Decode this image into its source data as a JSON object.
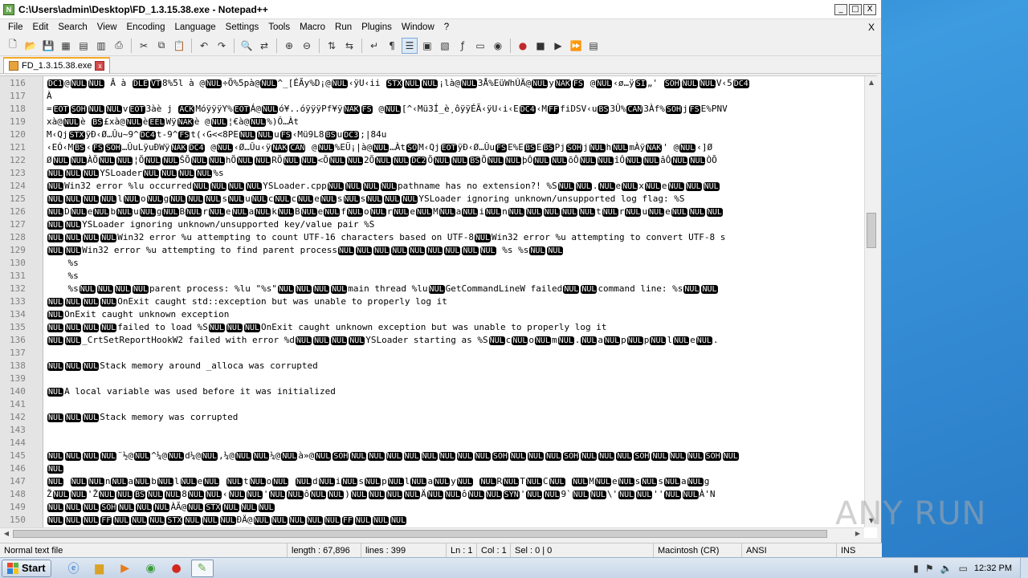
{
  "window": {
    "title": "C:\\Users\\admin\\Desktop\\FD_1.3.15.38.exe - Notepad++",
    "minimize": "_",
    "maximize": "□",
    "close": "X"
  },
  "menu": [
    "File",
    "Edit",
    "Search",
    "View",
    "Encoding",
    "Language",
    "Settings",
    "Tools",
    "Macro",
    "Run",
    "Plugins",
    "Window",
    "?"
  ],
  "menu_close_doc": "X",
  "toolbar_icons": [
    "new-file-icon",
    "open-file-icon",
    "save-icon",
    "save-all-icon",
    "close-icon",
    "close-all-icon",
    "print-icon",
    "cut-icon",
    "copy-icon",
    "paste-icon",
    "undo-icon",
    "redo-icon",
    "find-icon",
    "replace-icon",
    "zoom-in-icon",
    "zoom-out-icon",
    "sync-v-icon",
    "sync-h-icon",
    "word-wrap-icon",
    "all-chars-icon",
    "indent-guide-icon",
    "udl-icon",
    "doc-map-icon",
    "function-list-icon",
    "folder-workspace-icon",
    "monitor-icon",
    "record-icon",
    "stop-icon",
    "play-icon",
    "play-multiple-icon",
    "save-macro-icon"
  ],
  "tab": {
    "label": "FD_1.3.15.38.exe",
    "close": "x"
  },
  "lines": [
    {
      "n": "116",
      "text": "DC1@NULNUL Â à DLEVT8%5l à @NUL÷Ö%5pà@NUL^_[ÉÃy%D¡@NUL‹ÿU‹ii STXNULNUL¡là@NUL3Å%EüWhÚÄ@NULyNAKFS @NUL‹ø…ÿSI„' SOHNULNULV‹5DC4"
    },
    {
      "n": "117",
      "text": "À"
    },
    {
      "n": "118",
      "text": "=EOTSOHNULNULvEOT3àè j ACKMóÿÿÿY%EOTÁ@NULó¥..óÿÿÿPf¥ÿNAKFS @NUL[^‹Mü3Í_è¸ôÿÿÉÃ‹ÿU‹i‹EDC4‹MFFfiDSV‹uBS3Û%CAN3Àf%SOHjFSE%PNV"
    },
    {
      "n": "119",
      "text": "xà@NULè BS£xà@NULèEELWÿNAKè @NUL¦€à@NUL%)Ô…Àt"
    },
    {
      "n": "120",
      "text": "M‹QjSTXÿÐ‹Ø…Ûu~9^DC4t-9^FSt(‹G<<8PENULNULuFS‹Mü9L8BSuDC3;|84u"
    },
    {
      "n": "121",
      "text": "‹EÓ‹MBS‹FSSOH…ÛuLÿuÐWÿNAKDC4 @NUL‹Ø…Ûu‹ÿNAKCAN @NUL%EÜ¡|à@NUL…ÀtSOM‹QjEOTÿÐ‹Ø…ÛuFSE%EBSEBSPjSOHjNULhNULmÀÿNAK' @NUL‹]Ø"
    },
    {
      "n": "122",
      "text": "ØNULNULÀÕNULNUL¦ÕNULNULŠÕNULNULhÕNULNULRÕNULNUL<ÕNULNUL2ÕNULNULDC2ÕNULNULBSÕNULNULþÔNULNULõÔNULNULîÔNULNULâÔNULNULÒÕ"
    },
    {
      "n": "123",
      "text": "NULNULNULYSLoaderNULNULNULNUL%s"
    },
    {
      "n": "124",
      "text": "NULWin32 error %lu occurredNULNULNULNULYSLoader.cppNULNULNULNULpathname has no extension?! %SNULNUL.NULeNULxNULeNULNULNUL"
    },
    {
      "n": "125",
      "text": "NULNULNULNULlNULoNULgNULNULNULsNULuNULcNULcNULeNULsNULsNULNULNULYSLoader ignoring unknown/unsupported log flag: %S"
    },
    {
      "n": "126",
      "text": "NULDNULeNULbNULuNULgNULBNULrNULeNULaNULkNULBNULeNULfNULoNULrNULeNULMNULaNULiNULnNULNULNULNULNULtNULrNULuNULeNULNULNUL"
    },
    {
      "n": "127",
      "text": "NULNULYSLoader ignoring unknown/unsupported key/value pair %S"
    },
    {
      "n": "128",
      "text": "NULNULNULNULWin32 error %u attempting to count UTF-16 characters based on UTF-8NULWin32 error %u attempting to convert UTF-8 s"
    },
    {
      "n": "129",
      "text": "NULNULWin32 error %u attempting to find parent processNULNULNULNULNULNULNULNULNUL %s %sNULNUL"
    },
    {
      "n": "130",
      "text": "    %s"
    },
    {
      "n": "131",
      "text": "    %s"
    },
    {
      "n": "132",
      "text": "    %sNULNULNULNULparent process: %lu \"%s\"NULNULNULNULmain thread %luNULGetCommandLineW failedNULNULcommand line: %sNULNUL"
    },
    {
      "n": "133",
      "text": "NULNULNULNULOnExit caught std::exception but was unable to properly log it"
    },
    {
      "n": "134",
      "text": "NULOnExit caught unknown exception"
    },
    {
      "n": "135",
      "text": "NULNULNULNULfailed to load %SNULNULNULOnExit caught unknown exception but was unable to properly log it"
    },
    {
      "n": "136",
      "text": "NULNUL_CrtSetReportHookW2 failed with error %dNULNULNULNULYSLoader starting as %SNULcNULoNULmNUL.NULaNULpNULpNULlNULeNUL."
    },
    {
      "n": "137",
      "text": ""
    },
    {
      "n": "138",
      "text": "NULNULNULStack memory around _alloca was corrupted"
    },
    {
      "n": "139",
      "text": ""
    },
    {
      "n": "140",
      "text": "NULA local variable was used before it was initialized"
    },
    {
      "n": "141",
      "text": ""
    },
    {
      "n": "142",
      "text": "NULNULNULStack memory was corrupted"
    },
    {
      "n": "143",
      "text": ""
    },
    {
      "n": "144",
      "text": ""
    },
    {
      "n": "145",
      "text": "NULNULNULNUL¨½@NUL^¼@NULd¼@NUL,¼@NULNUL¼@NULà»@NULSOHNULNULNULNULNULNULNULNULSOHNULNULNULSOHNULNULNULSOHNULNULNULSOHNUL"
    },
    {
      "n": "146",
      "text": "NUL"
    },
    {
      "n": "147",
      "text": "NUL NULNULnNULaNULbNULlNULeNUL NULtNULoNUL NULdNULiNULsNULpNULlNULaNULyNUL NULRNULTNULCNUL NULMNULeNULsNULsNULaNULg"
    },
    {
      "n": "148",
      "text": "ŽNULNUL'ŽNULNULBSNULNUL8NULNUL‹NULNUL'NULNULôNULNUL)NULNULNULNULÄNULNULôNULNULSYN'NULNUL9`NULNUL\\'NULNUL''NULNULÀ'N"
    },
    {
      "n": "149",
      "text": "NULNULNULSOHNULNULNULÀÃ@NULSTXNULNULNUL"
    },
    {
      "n": "150",
      "text": "NULNULNULFFNULNULNULSTXNULNULNULÐÄ@NULNULNULNULNULFFNULNULNUL"
    }
  ],
  "status": {
    "type": "Normal text file",
    "length": "length : 67,896",
    "lines": "lines : 399",
    "ln": "Ln : 1",
    "col": "Col : 1",
    "sel": "Sel : 0 | 0",
    "eol": "Macintosh (CR)",
    "encoding": "ANSI",
    "mode": "INS"
  },
  "watermark": "ANY RUN",
  "taskbar": {
    "start_label": "Start",
    "apps": [
      "ie-icon",
      "explorer-icon",
      "media-player-icon",
      "chrome-icon",
      "opera-icon",
      "notepadpp-icon"
    ],
    "clock": "12:32 PM"
  }
}
